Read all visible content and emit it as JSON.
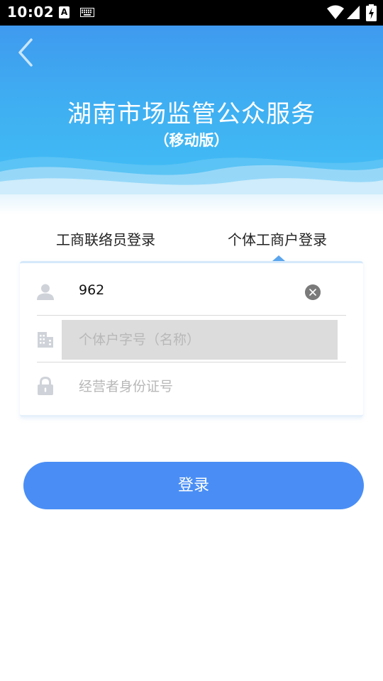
{
  "status_bar": {
    "time": "10:02",
    "keyboard_badge": "A",
    "icons": [
      "text-input-badge-icon",
      "keyboard-icon",
      "wifi-icon",
      "cell-signal-icon",
      "battery-charging-icon"
    ]
  },
  "header": {
    "title": "湖南市场监管公众服务",
    "subtitle": "（移动版）",
    "back_icon": "chevron-left-icon"
  },
  "tabs": [
    {
      "label": "工商联络员登录",
      "selected": false
    },
    {
      "label": "个体工商户登录",
      "selected": true
    }
  ],
  "form": {
    "account": {
      "value": "962",
      "icon": "user-icon",
      "clear_icon": "clear-icon"
    },
    "business_name": {
      "placeholder": "个体户字号（名称）",
      "icon": "building-icon"
    },
    "operator_id": {
      "placeholder": "经营者身份证号",
      "icon": "lock-icon"
    }
  },
  "login_button": {
    "label": "登录"
  },
  "colors": {
    "header_top": "#3f9aef",
    "header_bottom": "#43c3f6",
    "button": "#4a8ef5",
    "tab_caret": "#5aa5ee",
    "icon_gray": "#cfd3d9"
  }
}
